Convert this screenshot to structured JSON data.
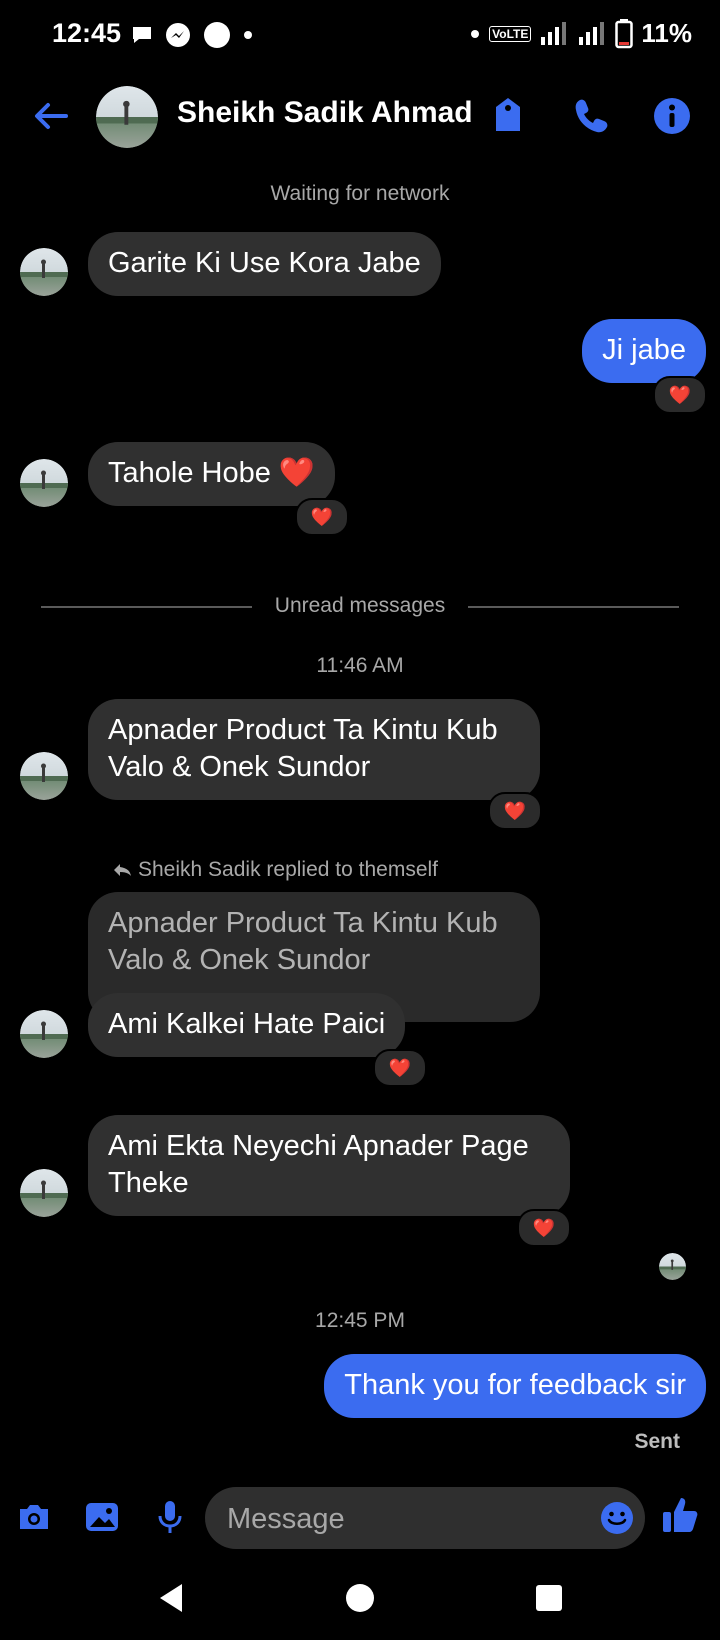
{
  "status_bar": {
    "time": "12:45",
    "battery": "11%",
    "volte": "VoLTE"
  },
  "header": {
    "contact_name": "Sheikh Sadik Ahmad"
  },
  "notices": {
    "network": "Waiting for network",
    "unread": "Unread messages"
  },
  "timestamps": {
    "t1": "11:46 AM",
    "t2": "12:45 PM"
  },
  "messages": {
    "m1": "Garite Ki Use Kora Jabe",
    "m2": "Ji jabe",
    "m3": "Tahole Hobe ❤️",
    "m4": "Apnader Product Ta Kintu Kub Valo & Onek Sundor",
    "reply_note": "Sheikh Sadik replied to themself",
    "m5_quoted": "Apnader Product Ta Kintu Kub Valo & Onek Sundor",
    "m5": "Ami Kalkei Hate Paici",
    "m6": "Ami Ekta Neyechi Apnader Page Theke",
    "m7": "Thank you for feedback sir",
    "sent_status": "Sent"
  },
  "reactions": {
    "heart": "❤️"
  },
  "composer": {
    "placeholder": "Message"
  },
  "colors": {
    "accent": "#3b6cf0",
    "bubble_in": "#303030",
    "background": "#000000"
  },
  "icons": [
    "back-arrow-icon",
    "tag-icon",
    "phone-icon",
    "info-icon",
    "camera-icon",
    "gallery-icon",
    "microphone-icon",
    "emoji-icon",
    "like-icon",
    "nav-back-icon",
    "nav-home-icon",
    "nav-recents-icon"
  ]
}
